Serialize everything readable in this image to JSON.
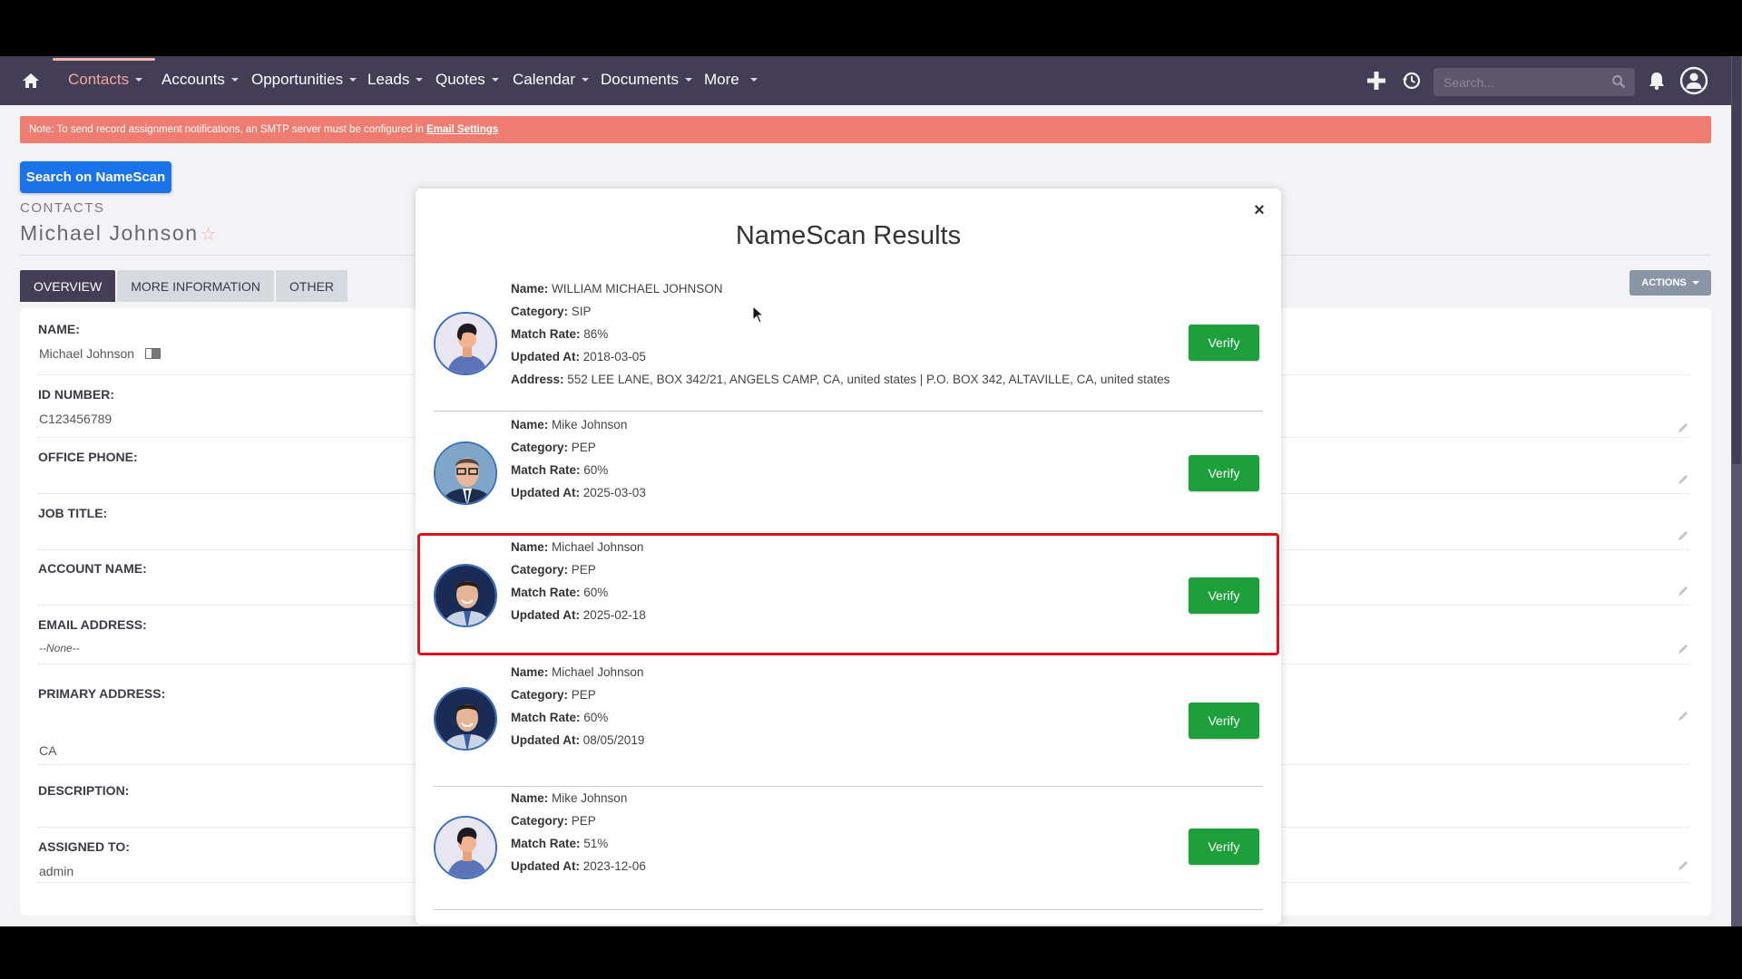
{
  "nav": {
    "items": [
      {
        "label": "Contacts",
        "active": true
      },
      {
        "label": "Accounts"
      },
      {
        "label": "Opportunities"
      },
      {
        "label": "Leads"
      },
      {
        "label": "Quotes"
      },
      {
        "label": "Calendar"
      },
      {
        "label": "Documents"
      },
      {
        "label": "More"
      }
    ],
    "search_placeholder": "Search...",
    "icons": [
      "home-icon",
      "plus-icon",
      "history-icon",
      "search-icon",
      "bell-icon",
      "user-avatar-icon"
    ]
  },
  "note": {
    "text": "Note: To send record assignment notifications, an SMTP server must be configured in ",
    "link": "Email Settings"
  },
  "namescan_button": "Search on NameScan",
  "module": "CONTACTS",
  "record_title": "Michael Johnson",
  "tabs": [
    {
      "label": "OVERVIEW",
      "active": true
    },
    {
      "label": "MORE INFORMATION"
    },
    {
      "label": "OTHER"
    }
  ],
  "actions_label": "ACTIONS",
  "fields": [
    {
      "label": "NAME:",
      "value": "Michael Johnson"
    },
    {
      "label": "ID NUMBER:",
      "value": "C123456789"
    },
    {
      "label": "OFFICE PHONE:",
      "value": ""
    },
    {
      "label": "JOB TITLE:",
      "value": ""
    },
    {
      "label": "ACCOUNT NAME:",
      "value": ""
    },
    {
      "label": "EMAIL ADDRESS:",
      "value": "--None--"
    },
    {
      "label": "PRIMARY ADDRESS:",
      "value": "CA"
    },
    {
      "label": "DESCRIPTION:",
      "value": ""
    },
    {
      "label": "ASSIGNED TO:",
      "value": "admin"
    }
  ],
  "modal": {
    "title": "NameScan Results",
    "close_symbol": "×",
    "labels": {
      "name": "Name:",
      "category": "Category:",
      "match_rate": "Match Rate:",
      "updated_at": "Updated At:",
      "address": "Address:"
    },
    "verify_label": "Verify",
    "results": [
      {
        "name": "WILLIAM MICHAEL JOHNSON",
        "category": "SIP",
        "match_rate": "86%",
        "updated_at": "2018-03-05",
        "address": "552 LEE LANE, BOX 342/21, ANGELS CAMP, CA, united states | P.O. BOX 342, ALTAVILLE, CA, united states",
        "avatar": "illustrated-person"
      },
      {
        "name": "Mike Johnson",
        "category": "PEP",
        "match_rate": "60%",
        "updated_at": "2025-03-03",
        "avatar": "photo-glasses-man"
      },
      {
        "name": "Michael Johnson",
        "category": "PEP",
        "match_rate": "60%",
        "updated_at": "2025-02-18",
        "avatar": "photo-smiling-man",
        "highlighted": true
      },
      {
        "name": "Michael Johnson",
        "category": "PEP",
        "match_rate": "60%",
        "updated_at": "08/05/2019",
        "avatar": "photo-smiling-man"
      },
      {
        "name": "Mike Johnson",
        "category": "PEP",
        "match_rate": "51%",
        "updated_at": "2023-12-06",
        "avatar": "illustrated-person"
      }
    ]
  },
  "colors": {
    "nav_bg": "#433d55",
    "nav_active": "#f3a6a2",
    "note_bg": "#ef7c70",
    "primary_button": "#1a73e8",
    "verify_button": "#1d9f3b",
    "highlight_border": "#e0121a",
    "actions_button": "#8a96a6"
  }
}
